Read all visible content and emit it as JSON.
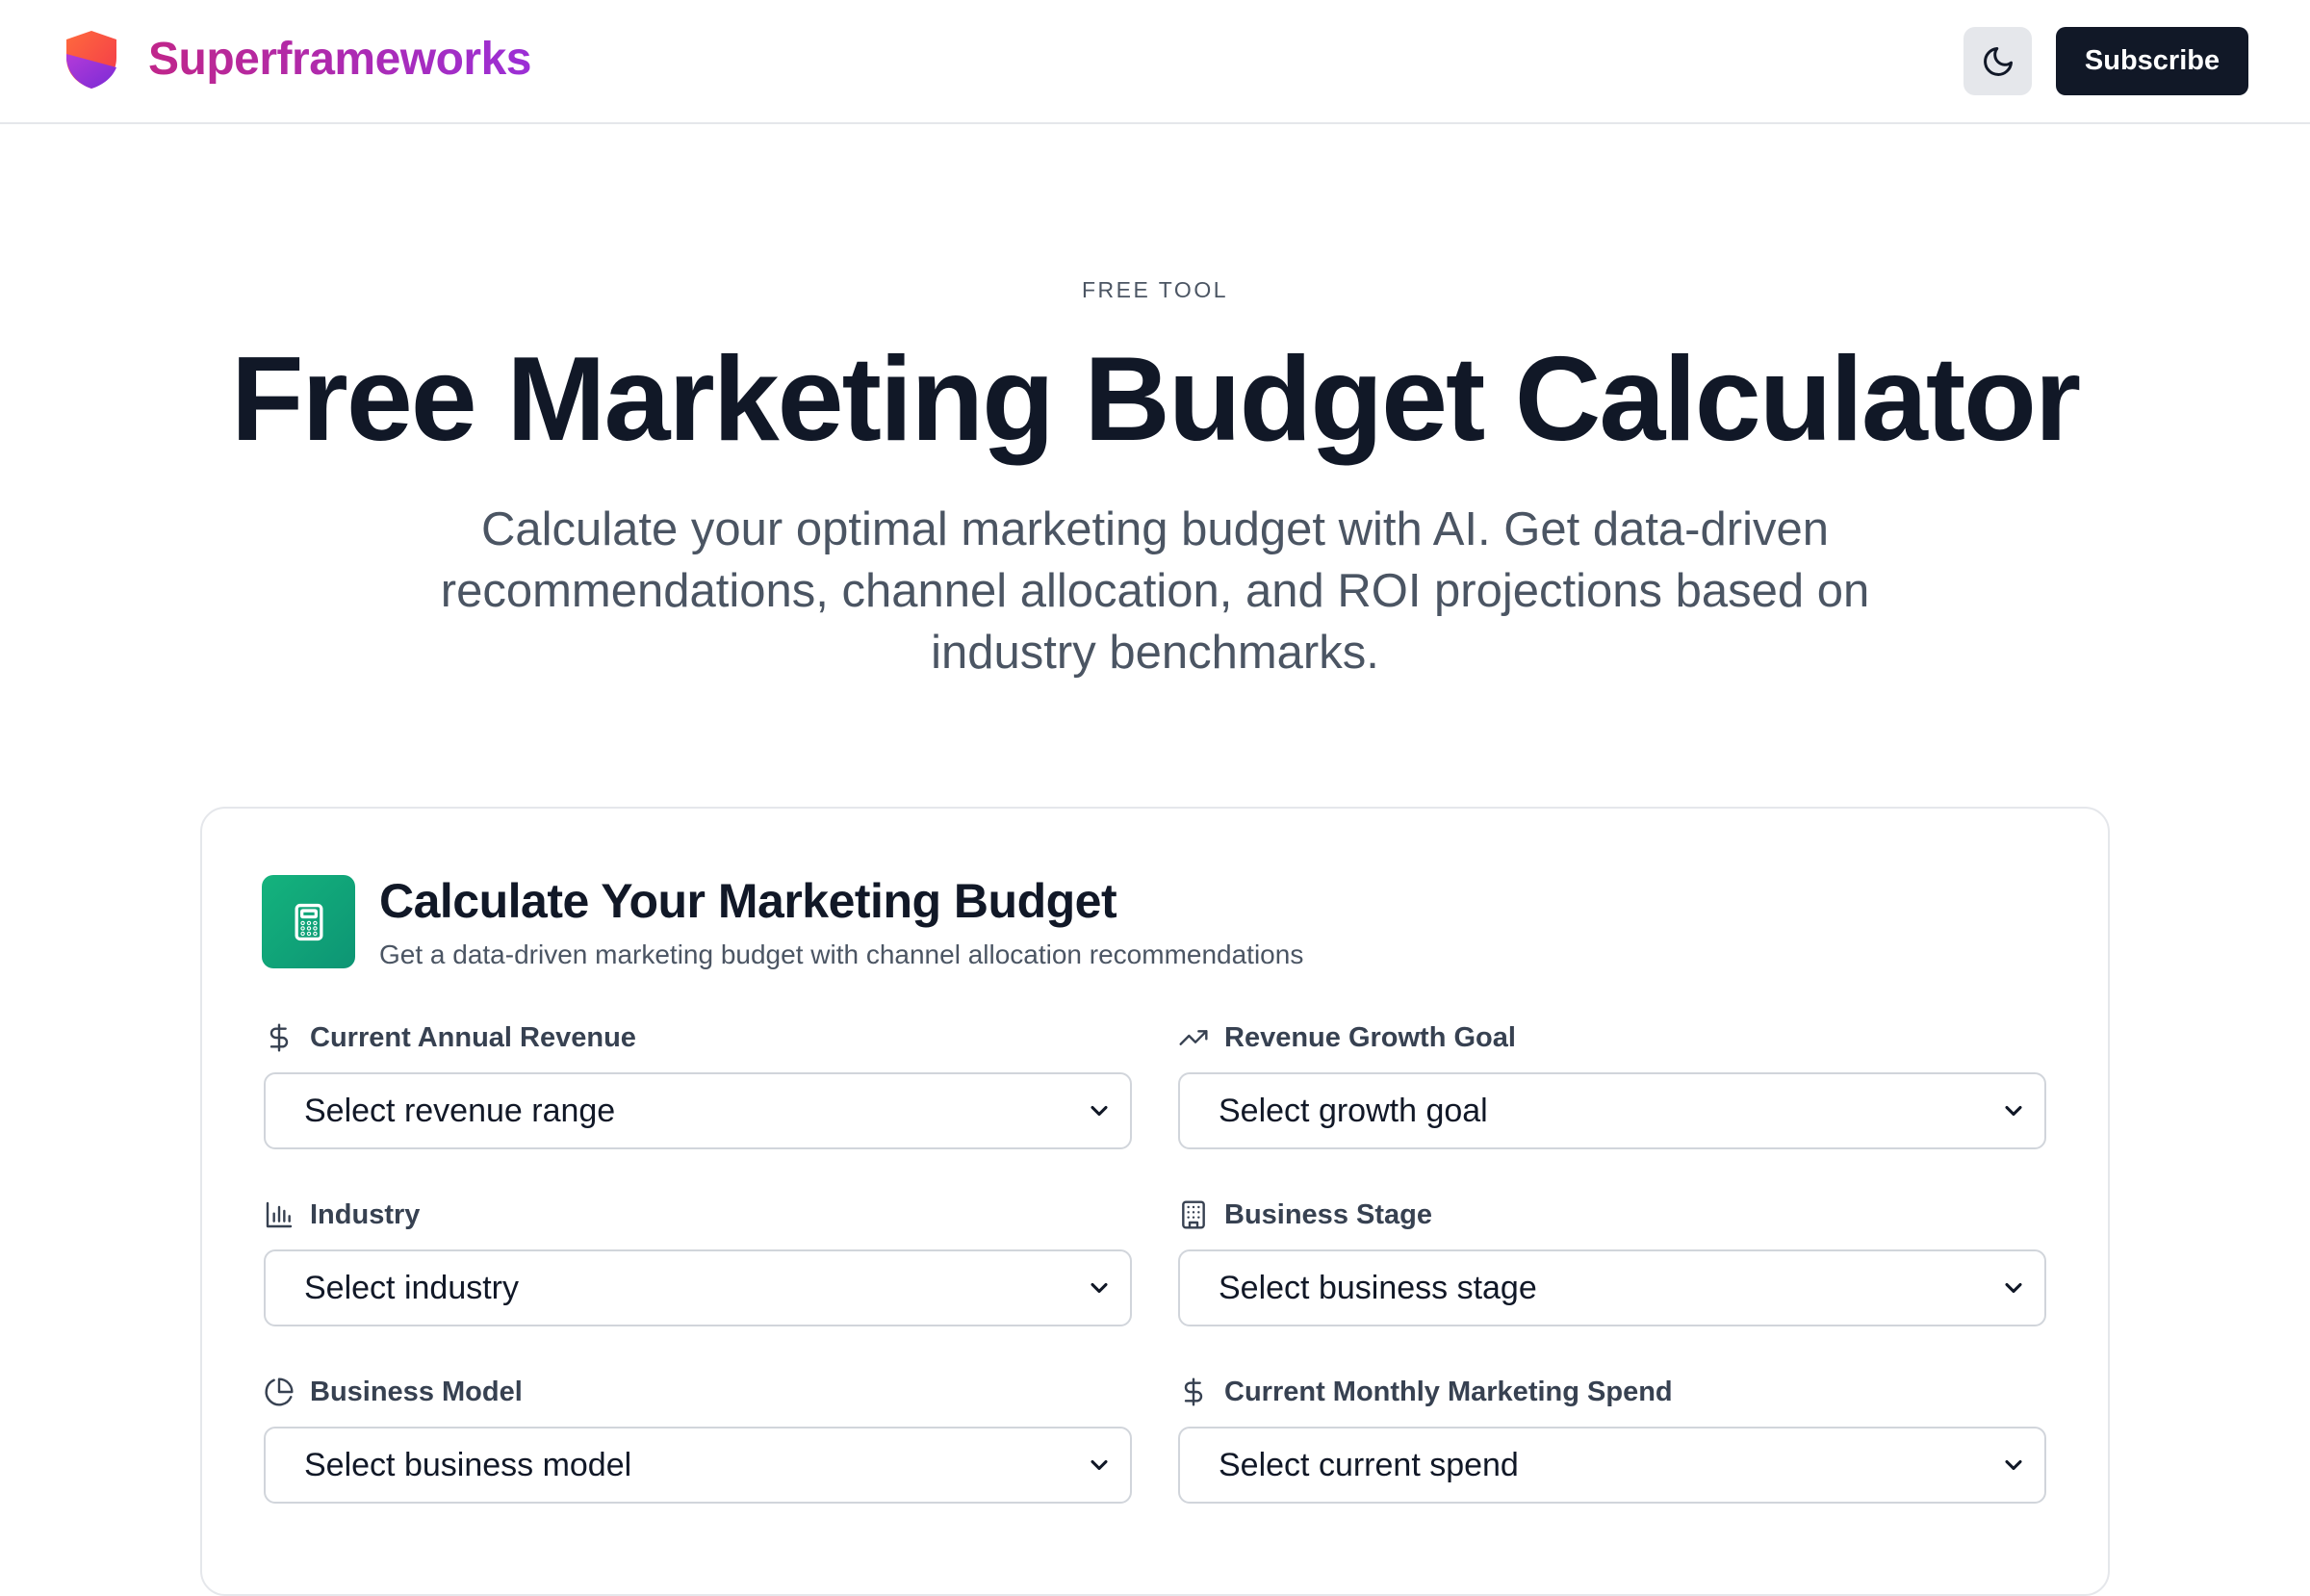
{
  "header": {
    "brand_name": "Superframeworks",
    "theme_toggle_icon": "moon-icon",
    "subscribe_label": "Subscribe"
  },
  "hero": {
    "eyebrow": "FREE TOOL",
    "title": "Free Marketing Budget Calculator",
    "subtitle": "Calculate your optimal marketing budget with AI. Get data-driven recommendations, channel allocation, and ROI projections based on industry benchmarks."
  },
  "card": {
    "icon": "calculator-icon",
    "title": "Calculate Your Marketing Budget",
    "subtitle": "Get a data-driven marketing budget with channel allocation recommendations",
    "fields": [
      {
        "label": "Current Annual Revenue",
        "icon": "dollar-icon",
        "value": "Select revenue range"
      },
      {
        "label": "Revenue Growth Goal",
        "icon": "trending-up-icon",
        "value": "Select growth goal"
      },
      {
        "label": "Industry",
        "icon": "bar-chart-icon",
        "value": "Select industry"
      },
      {
        "label": "Business Stage",
        "icon": "building-icon",
        "value": "Select business stage"
      },
      {
        "label": "Business Model",
        "icon": "pie-chart-icon",
        "value": "Select business model"
      },
      {
        "label": "Current Monthly Marketing Spend",
        "icon": "dollar-icon",
        "value": "Select current spend"
      }
    ]
  },
  "colors": {
    "brand_gradient_start": "#c0268a",
    "brand_gradient_end": "#9b2fd6",
    "primary_dark": "#111827",
    "card_icon_green": "#14b37d",
    "border": "#e5e7eb"
  }
}
